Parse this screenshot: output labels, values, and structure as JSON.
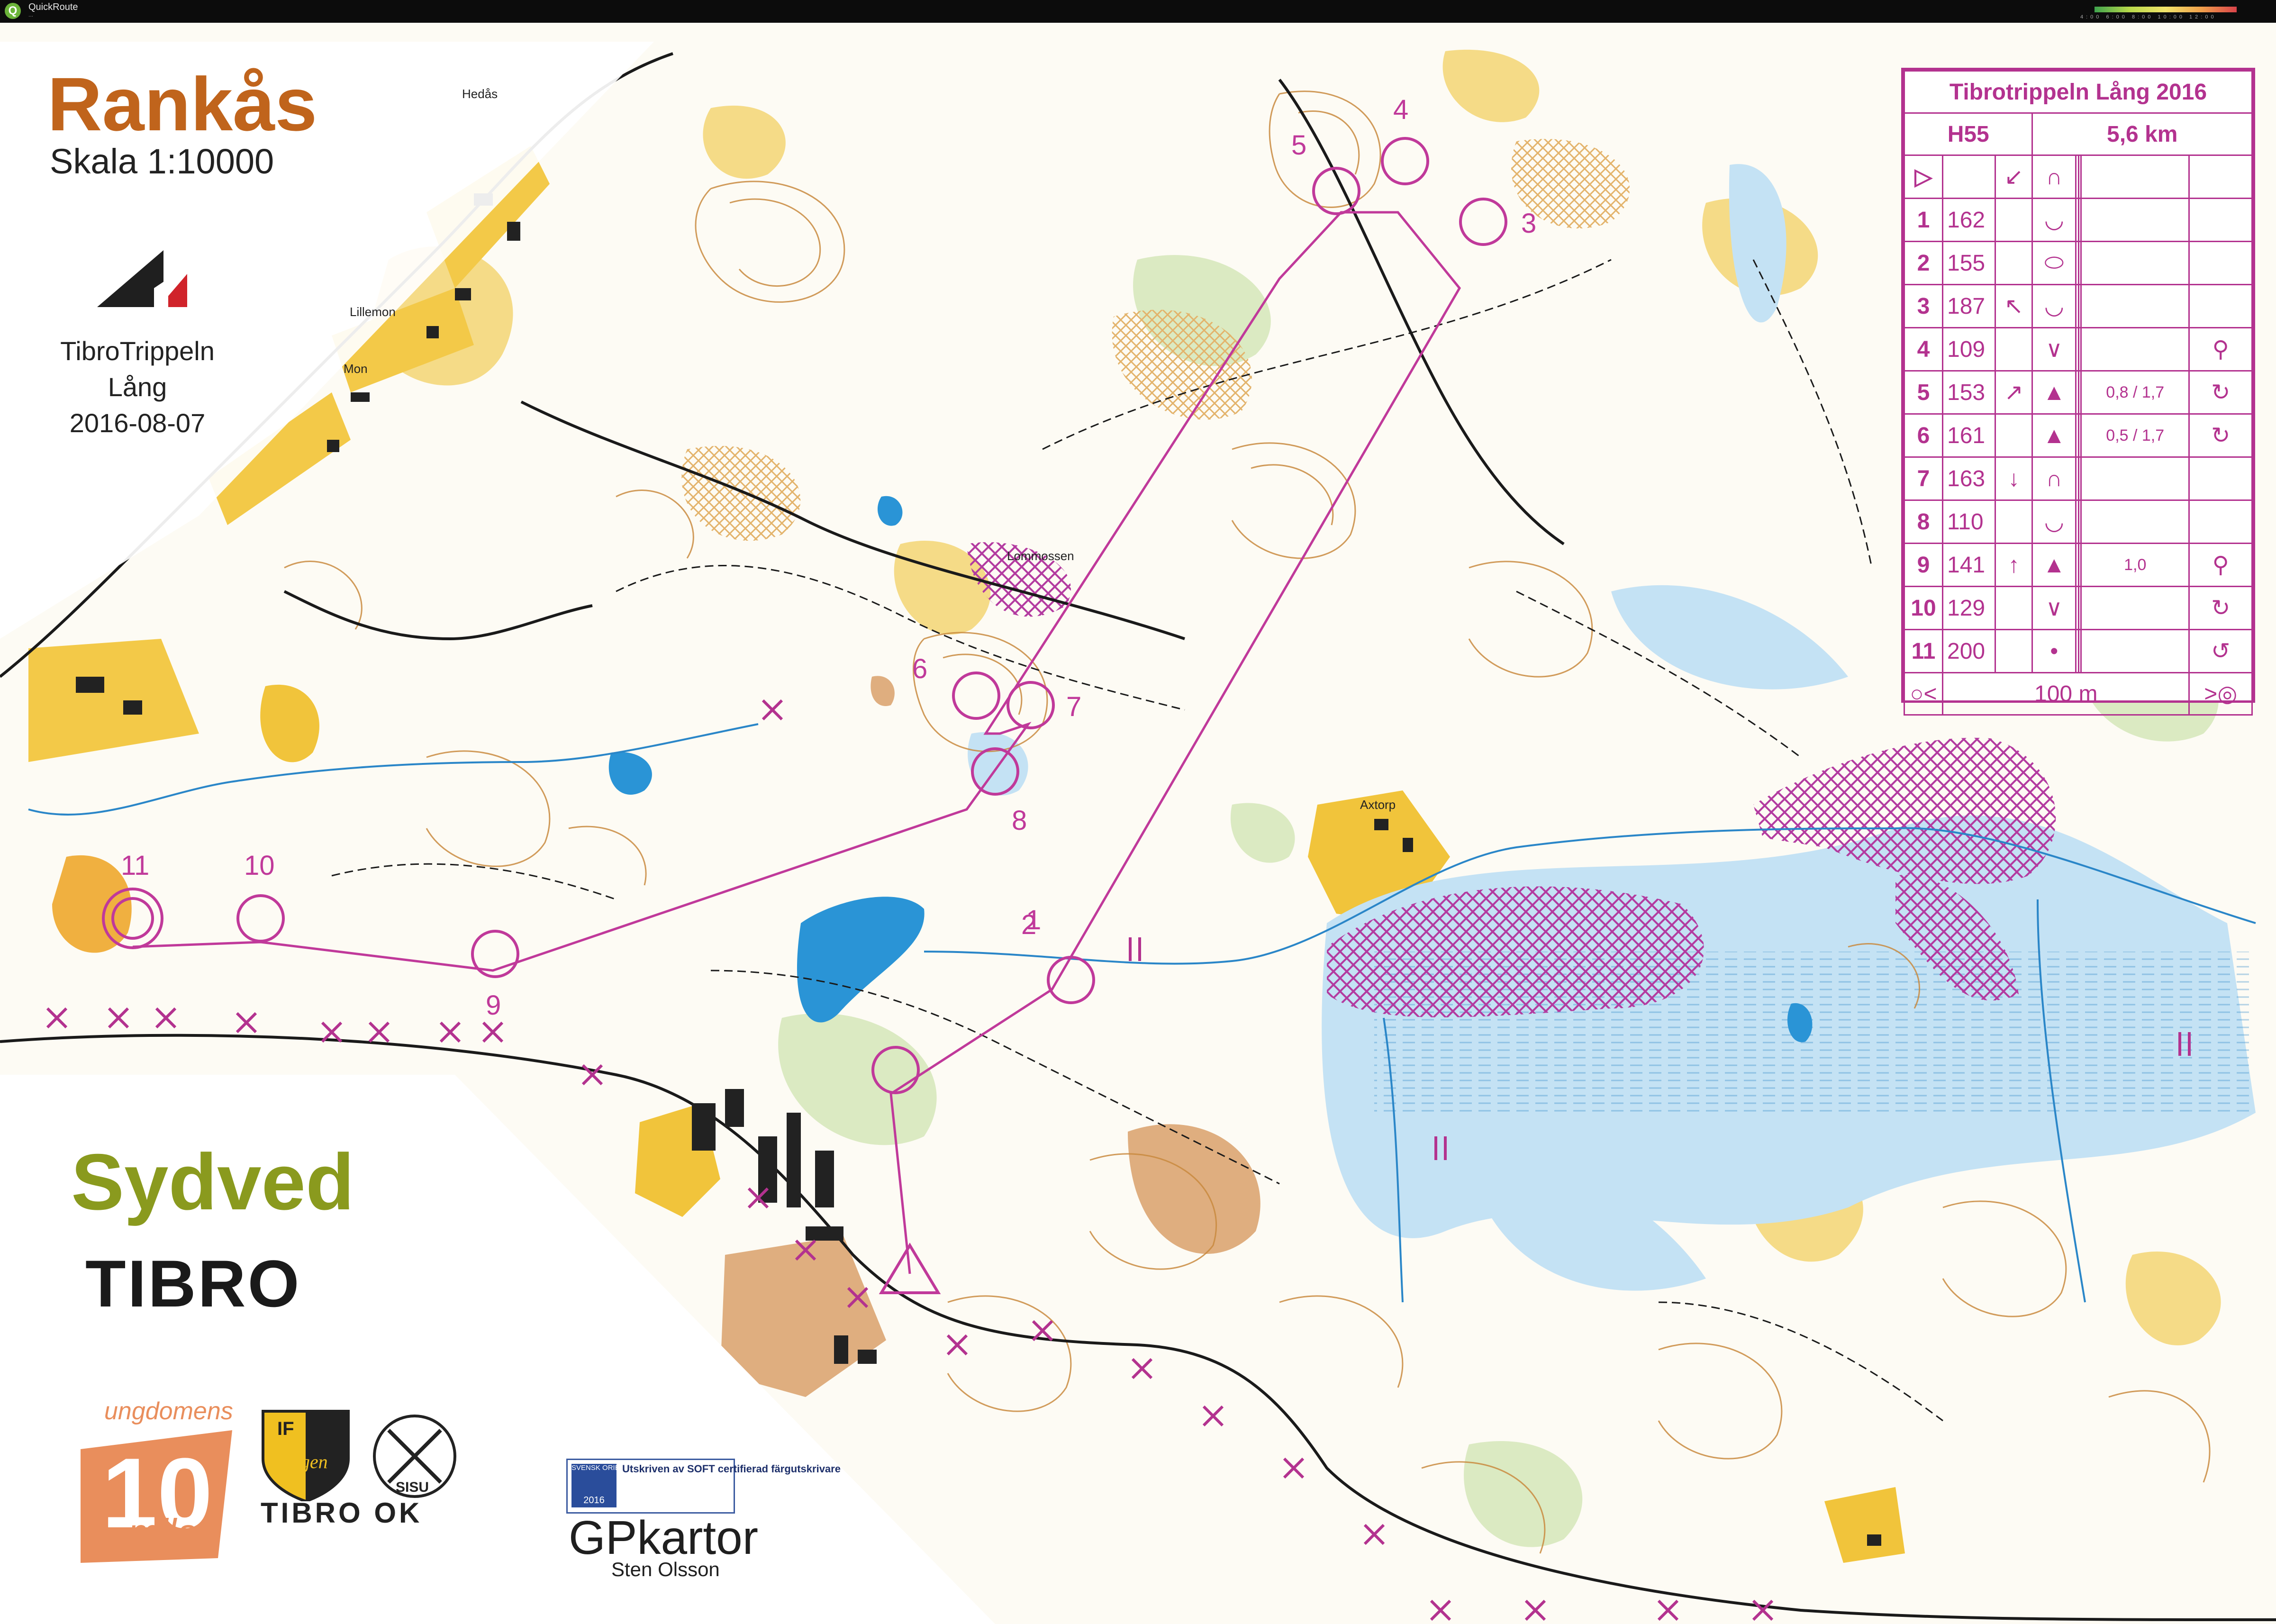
{
  "window": {
    "app_title": "QuickRoute",
    "subtitle": "...",
    "speed_scale_labels": [
      "4:00",
      "6:00",
      "8:00",
      "10:00",
      "12:00"
    ]
  },
  "map": {
    "title": "Rankås",
    "scale": "Skala 1:10000",
    "event_lines": [
      "TibroTrippeln",
      "Lång",
      "2016-08-07"
    ],
    "places": {
      "hedas": "Hedås",
      "lillemon": "Lillemon",
      "mon": "Mon",
      "axtorp": "Axtorp",
      "lommossen": "Lommossen"
    },
    "controls": [
      "1",
      "2",
      "3",
      "4",
      "5",
      "6",
      "7",
      "8",
      "9",
      "10",
      "11"
    ]
  },
  "sponsors": {
    "sydved": "Sydved",
    "tibro": "TIBRO",
    "tibro_ok": "TIBRO OK",
    "gp_kartor": "GPkartor",
    "gp_owner": "Sten Olsson",
    "ungdomens_top": "ungdomens",
    "ungdomens_number": "10",
    "ungdomens_mila": "mila",
    "hagen_top": "IF",
    "hagen_name": "Hagen",
    "sisu": "SISU",
    "soft_text": "Utskriven av SOFT certifierad färgutskrivare",
    "soft_logo": "SVENSK ORIENTERING",
    "soft_year": "2016"
  },
  "description": {
    "title": "Tibrotrippeln Lång 2016",
    "class": "H55",
    "length": "5,6 km",
    "rows": [
      {
        "n": "1",
        "code": "162",
        "dir": "",
        "feature": "◡",
        "dim": "",
        "extra": ""
      },
      {
        "n": "2",
        "code": "155",
        "dir": "",
        "feature": "⬭",
        "dim": "",
        "extra": ""
      },
      {
        "n": "3",
        "code": "187",
        "dir": "↖",
        "feature": "◡",
        "dim": "",
        "extra": ""
      },
      {
        "n": "4",
        "code": "109",
        "dir": "",
        "feature": "∨",
        "dim": "",
        "extra": "⚲"
      },
      {
        "n": "5",
        "code": "153",
        "dir": "↗",
        "feature": "▲",
        "dim": "0,8 / 1,7",
        "extra": "↻"
      },
      {
        "n": "6",
        "code": "161",
        "dir": "",
        "feature": "▲",
        "dim": "0,5 / 1,7",
        "extra": "↻"
      },
      {
        "n": "7",
        "code": "163",
        "dir": "↓",
        "feature": "∩",
        "dim": "",
        "extra": ""
      },
      {
        "n": "8",
        "code": "110",
        "dir": "",
        "feature": "◡",
        "dim": "",
        "extra": ""
      },
      {
        "n": "9",
        "code": "141",
        "dir": "↑",
        "feature": "▲",
        "dim": "1,0",
        "extra": "⚲"
      },
      {
        "n": "10",
        "code": "129",
        "dir": "",
        "feature": "∨",
        "dim": "",
        "extra": "↻"
      },
      {
        "n": "11",
        "code": "200",
        "dir": "",
        "feature": "•",
        "dim": "",
        "extra": "↺"
      }
    ],
    "footer": "100 m"
  },
  "colors": {
    "course": "#c0399a",
    "contour": "#c98a3e",
    "water": "#bde0f4",
    "open_land": "#f3c948",
    "green": "#cfe3b1",
    "title": "#c0641c"
  }
}
